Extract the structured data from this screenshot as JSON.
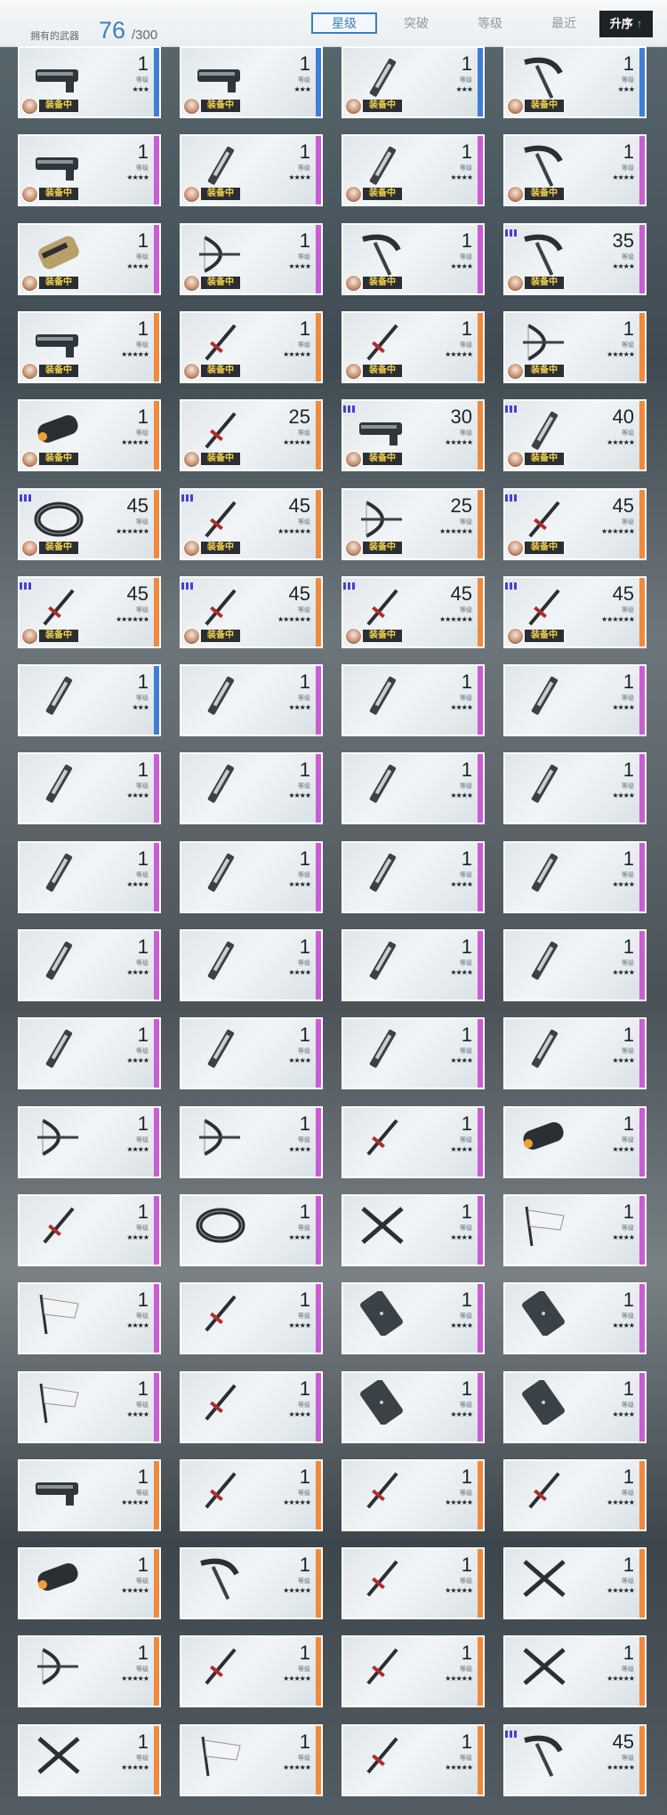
{
  "header": {
    "owned_label": "拥有的武器",
    "owned_count": "76",
    "owned_total": "/300",
    "tabs": [
      {
        "label": "星级",
        "active": true
      },
      {
        "label": "突破",
        "active": false
      },
      {
        "label": "等级",
        "active": false
      },
      {
        "label": "最近",
        "active": false
      }
    ],
    "sort_label": "升序",
    "sort_arrow": "↑"
  },
  "card_level_label": "等级",
  "equipped_label": "装备中",
  "colors": {
    "blue": "#3f7ed4",
    "purple": "#c95dd1",
    "orange": "#ef8a3c",
    "accent": "#3a7fc3"
  },
  "cards": [
    {
      "level": "1",
      "stars": "★★★",
      "rarity": "blue",
      "equipped": true,
      "icon": "gun-icon"
    },
    {
      "level": "1",
      "stars": "★★★",
      "rarity": "blue",
      "equipped": true,
      "icon": "gun-icon"
    },
    {
      "level": "1",
      "stars": "★★★",
      "rarity": "blue",
      "equipped": true,
      "icon": "blade-icon"
    },
    {
      "level": "1",
      "stars": "★★★",
      "rarity": "blue",
      "equipped": true,
      "icon": "scythe-icon"
    },
    {
      "level": "1",
      "stars": "★★★★",
      "rarity": "purple",
      "equipped": true,
      "icon": "gun-icon"
    },
    {
      "level": "1",
      "stars": "★★★★",
      "rarity": "purple",
      "equipped": true,
      "icon": "blade-icon"
    },
    {
      "level": "1",
      "stars": "★★★★",
      "rarity": "purple",
      "equipped": true,
      "icon": "blade-icon"
    },
    {
      "level": "1",
      "stars": "★★★★",
      "rarity": "purple",
      "equipped": true,
      "icon": "scythe-icon"
    },
    {
      "level": "1",
      "stars": "★★★★",
      "rarity": "purple",
      "equipped": true,
      "icon": "gauntlet-icon"
    },
    {
      "level": "1",
      "stars": "★★★★",
      "rarity": "purple",
      "equipped": true,
      "icon": "bow-icon"
    },
    {
      "level": "1",
      "stars": "★★★★",
      "rarity": "purple",
      "equipped": true,
      "icon": "scythe-icon"
    },
    {
      "level": "35",
      "stars": "★★★★",
      "rarity": "purple",
      "equipped": true,
      "icon": "scythe-icon",
      "badge": true
    },
    {
      "level": "1",
      "stars": "★★★★★",
      "rarity": "orange",
      "equipped": true,
      "icon": "gun-icon"
    },
    {
      "level": "1",
      "stars": "★★★★★",
      "rarity": "orange",
      "equipped": true,
      "icon": "sword-icon"
    },
    {
      "level": "1",
      "stars": "★★★★★",
      "rarity": "orange",
      "equipped": true,
      "icon": "sword-icon"
    },
    {
      "level": "1",
      "stars": "★★★★★",
      "rarity": "orange",
      "equipped": true,
      "icon": "bow-icon"
    },
    {
      "level": "1",
      "stars": "★★★★★",
      "rarity": "orange",
      "equipped": true,
      "icon": "cannon-icon"
    },
    {
      "level": "25",
      "stars": "★★★★★",
      "rarity": "orange",
      "equipped": true,
      "icon": "sword-icon"
    },
    {
      "level": "30",
      "stars": "★★★★★",
      "rarity": "orange",
      "equipped": true,
      "icon": "gun-icon",
      "badge": true
    },
    {
      "level": "40",
      "stars": "★★★★★",
      "rarity": "orange",
      "equipped": true,
      "icon": "blade-icon",
      "badge": true
    },
    {
      "level": "45",
      "stars": "★★★★★★",
      "rarity": "orange",
      "equipped": true,
      "icon": "ring-icon",
      "badge": true
    },
    {
      "level": "45",
      "stars": "★★★★★★",
      "rarity": "orange",
      "equipped": true,
      "icon": "sword-icon",
      "badge": true
    },
    {
      "level": "25",
      "stars": "★★★★★★",
      "rarity": "orange",
      "equipped": true,
      "icon": "bow-icon"
    },
    {
      "level": "45",
      "stars": "★★★★★★",
      "rarity": "orange",
      "equipped": true,
      "icon": "sword-icon",
      "badge": true
    },
    {
      "level": "45",
      "stars": "★★★★★★",
      "rarity": "orange",
      "equipped": true,
      "icon": "sword-icon",
      "badge": true
    },
    {
      "level": "45",
      "stars": "★★★★★★",
      "rarity": "orange",
      "equipped": true,
      "icon": "sword-icon",
      "badge": true
    },
    {
      "level": "45",
      "stars": "★★★★★★",
      "rarity": "orange",
      "equipped": true,
      "icon": "sword-icon",
      "badge": true
    },
    {
      "level": "45",
      "stars": "★★★★★★",
      "rarity": "orange",
      "equipped": true,
      "icon": "sword-icon",
      "badge": true
    },
    {
      "level": "1",
      "stars": "★★★",
      "rarity": "blue",
      "icon": "blade-icon"
    },
    {
      "level": "1",
      "stars": "★★★★",
      "rarity": "purple",
      "icon": "blade-icon"
    },
    {
      "level": "1",
      "stars": "★★★★",
      "rarity": "purple",
      "icon": "blade-icon"
    },
    {
      "level": "1",
      "stars": "★★★★",
      "rarity": "purple",
      "icon": "blade-icon"
    },
    {
      "level": "1",
      "stars": "★★★★",
      "rarity": "purple",
      "icon": "blade-icon"
    },
    {
      "level": "1",
      "stars": "★★★★",
      "rarity": "purple",
      "icon": "blade-icon"
    },
    {
      "level": "1",
      "stars": "★★★★",
      "rarity": "purple",
      "icon": "blade-icon"
    },
    {
      "level": "1",
      "stars": "★★★★",
      "rarity": "purple",
      "icon": "blade-icon"
    },
    {
      "level": "1",
      "stars": "★★★★",
      "rarity": "purple",
      "icon": "blade-icon"
    },
    {
      "level": "1",
      "stars": "★★★★",
      "rarity": "purple",
      "icon": "blade-icon"
    },
    {
      "level": "1",
      "stars": "★★★★",
      "rarity": "purple",
      "icon": "blade-icon"
    },
    {
      "level": "1",
      "stars": "★★★★",
      "rarity": "purple",
      "icon": "blade-icon"
    },
    {
      "level": "1",
      "stars": "★★★★",
      "rarity": "purple",
      "icon": "blade-icon"
    },
    {
      "level": "1",
      "stars": "★★★★",
      "rarity": "purple",
      "icon": "blade-icon"
    },
    {
      "level": "1",
      "stars": "★★★★",
      "rarity": "purple",
      "icon": "blade-icon"
    },
    {
      "level": "1",
      "stars": "★★★★",
      "rarity": "purple",
      "icon": "blade-icon"
    },
    {
      "level": "1",
      "stars": "★★★★",
      "rarity": "purple",
      "icon": "blade-icon"
    },
    {
      "level": "1",
      "stars": "★★★★",
      "rarity": "purple",
      "icon": "blade-icon"
    },
    {
      "level": "1",
      "stars": "★★★★",
      "rarity": "purple",
      "icon": "blade-icon"
    },
    {
      "level": "1",
      "stars": "★★★★",
      "rarity": "purple",
      "icon": "blade-icon"
    },
    {
      "level": "1",
      "stars": "★★★★",
      "rarity": "purple",
      "icon": "bow-icon"
    },
    {
      "level": "1",
      "stars": "★★★★",
      "rarity": "purple",
      "icon": "bow-icon"
    },
    {
      "level": "1",
      "stars": "★★★★",
      "rarity": "purple",
      "icon": "sword-icon"
    },
    {
      "level": "1",
      "stars": "★★★★",
      "rarity": "purple",
      "icon": "cannon-icon"
    },
    {
      "level": "1",
      "stars": "★★★★",
      "rarity": "purple",
      "icon": "sword-icon"
    },
    {
      "level": "1",
      "stars": "★★★★",
      "rarity": "purple",
      "icon": "ring-icon"
    },
    {
      "level": "1",
      "stars": "★★★★",
      "rarity": "purple",
      "icon": "cross-icon"
    },
    {
      "level": "1",
      "stars": "★★★★",
      "rarity": "purple",
      "icon": "flag-icon"
    },
    {
      "level": "1",
      "stars": "★★★★",
      "rarity": "purple",
      "icon": "flag-icon"
    },
    {
      "level": "1",
      "stars": "★★★★",
      "rarity": "purple",
      "icon": "sword-icon"
    },
    {
      "level": "1",
      "stars": "★★★★",
      "rarity": "purple",
      "icon": "shield-icon"
    },
    {
      "level": "1",
      "stars": "★★★★",
      "rarity": "purple",
      "icon": "shield-icon"
    },
    {
      "level": "1",
      "stars": "★★★★",
      "rarity": "purple",
      "icon": "flag-icon"
    },
    {
      "level": "1",
      "stars": "★★★★",
      "rarity": "purple",
      "icon": "sword-icon"
    },
    {
      "level": "1",
      "stars": "★★★★",
      "rarity": "purple",
      "icon": "shield-icon"
    },
    {
      "level": "1",
      "stars": "★★★★",
      "rarity": "purple",
      "icon": "shield-icon"
    },
    {
      "level": "1",
      "stars": "★★★★★",
      "rarity": "orange",
      "icon": "gun-icon"
    },
    {
      "level": "1",
      "stars": "★★★★★",
      "rarity": "orange",
      "icon": "sword-icon"
    },
    {
      "level": "1",
      "stars": "★★★★★",
      "rarity": "orange",
      "icon": "sword-icon"
    },
    {
      "level": "1",
      "stars": "★★★★★",
      "rarity": "orange",
      "icon": "sword-icon"
    },
    {
      "level": "1",
      "stars": "★★★★★",
      "rarity": "orange",
      "icon": "cannon-icon"
    },
    {
      "level": "1",
      "stars": "★★★★★",
      "rarity": "orange",
      "icon": "scythe-icon"
    },
    {
      "level": "1",
      "stars": "★★★★★",
      "rarity": "orange",
      "icon": "sword-icon"
    },
    {
      "level": "1",
      "stars": "★★★★★",
      "rarity": "orange",
      "icon": "cross-icon"
    },
    {
      "level": "1",
      "stars": "★★★★★",
      "rarity": "orange",
      "icon": "bow-icon"
    },
    {
      "level": "1",
      "stars": "★★★★★",
      "rarity": "orange",
      "icon": "sword-icon"
    },
    {
      "level": "1",
      "stars": "★★★★★",
      "rarity": "orange",
      "icon": "sword-icon"
    },
    {
      "level": "1",
      "stars": "★★★★★",
      "rarity": "orange",
      "icon": "cross-icon"
    },
    {
      "level": "1",
      "stars": "★★★★★",
      "rarity": "orange",
      "icon": "cross-icon"
    },
    {
      "level": "1",
      "stars": "★★★★★",
      "rarity": "orange",
      "icon": "flag-icon"
    },
    {
      "level": "1",
      "stars": "★★★★★",
      "rarity": "orange",
      "icon": "sword-icon"
    },
    {
      "level": "45",
      "stars": "★★★★★",
      "rarity": "orange",
      "icon": "scythe-icon",
      "badge": true
    }
  ]
}
